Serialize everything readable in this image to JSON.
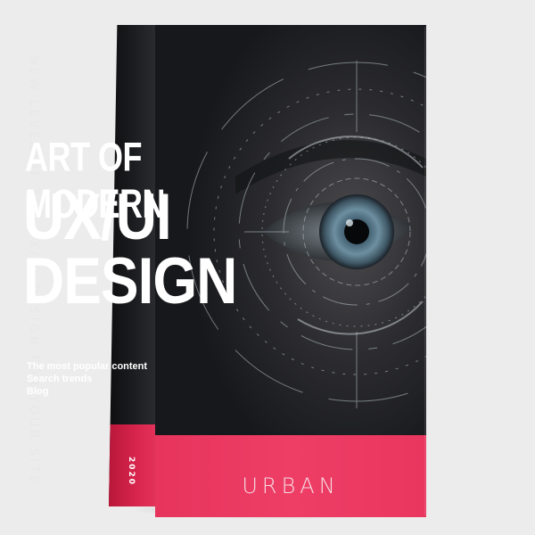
{
  "book": {
    "title_line1": "ART OF MODERN",
    "title_line2": "UX/UI",
    "title_line3": "DESIGN",
    "bullets": [
      "The most popular content",
      "Search trends",
      "Blog"
    ],
    "brand": "URBAN",
    "spine_text": "NEW LEVEL OF THE UX/UI DESIGN FOR YOUR SITE",
    "spine_year": "2020"
  },
  "colors": {
    "background": "#ececec",
    "cover_dark": "#1c1d20",
    "accent_band": "#ec3b63",
    "iris": "#5b7c8e"
  },
  "icons": [
    "eye-illustration",
    "hud-ring-icon"
  ]
}
